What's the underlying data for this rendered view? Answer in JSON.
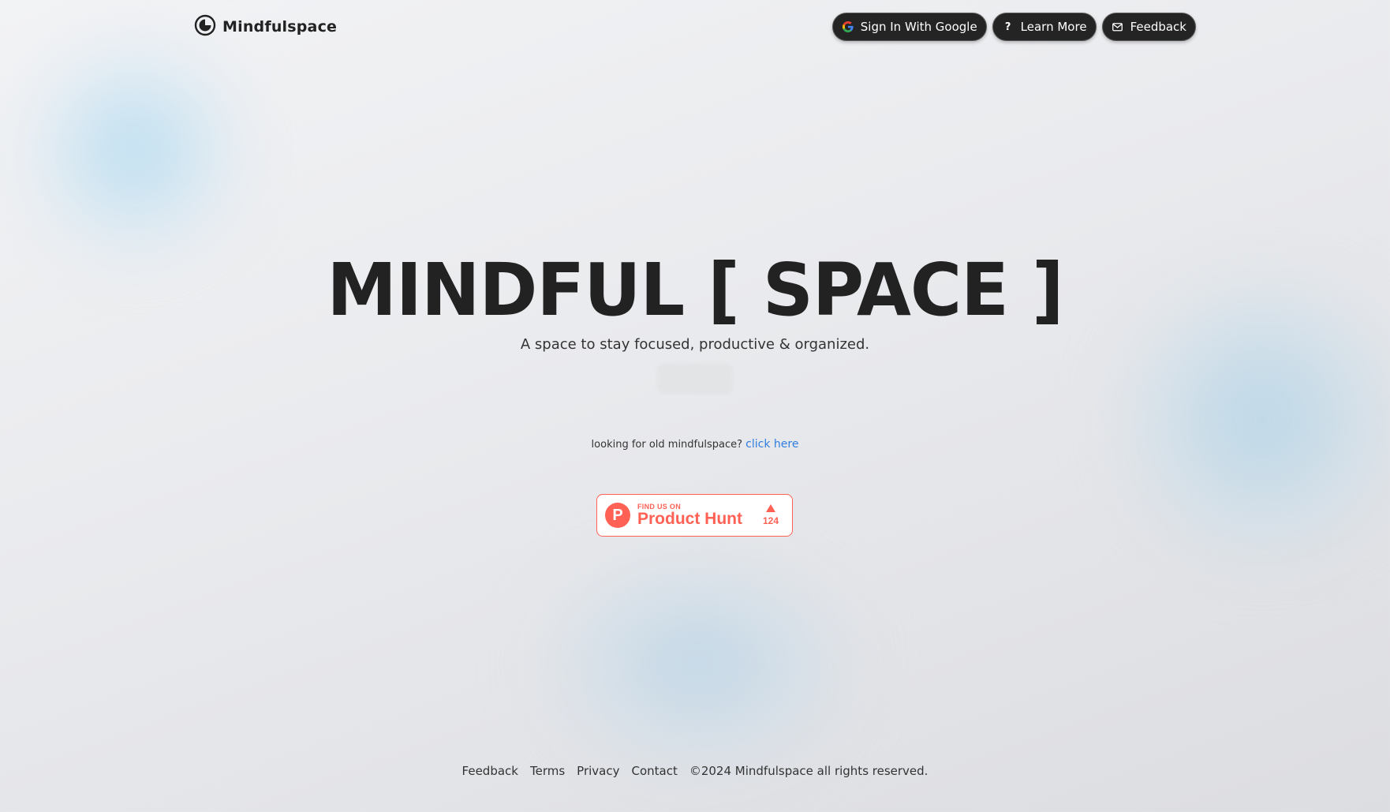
{
  "brand": {
    "name": "Mindfulspace"
  },
  "nav": {
    "signin_label": "Sign In With Google",
    "learn_label": "Learn More",
    "feedback_label": "Feedback"
  },
  "hero": {
    "title": "MINDFUL [ SPACE ]",
    "subtitle": "A space to stay focused, productive & organized."
  },
  "old_link": {
    "prompt": "looking for old mindfulspace?",
    "link_text": "click here"
  },
  "product_hunt": {
    "small_text": "FIND US ON",
    "big_text": "Product Hunt",
    "votes": "124"
  },
  "footer": {
    "links": [
      "Feedback",
      "Terms",
      "Privacy",
      "Contact"
    ],
    "copyright": "©2024 Mindfulspace all rights reserved."
  },
  "colors": {
    "button_bg": "#242424",
    "link_blue": "#2f7de1",
    "product_hunt": "#ff6154",
    "google_blue": "#4285f4",
    "google_red": "#ea4335",
    "google_yellow": "#fbbc05",
    "google_green": "#34a853"
  },
  "icons": {
    "brand": "pie-logo-icon",
    "signin": "google-icon",
    "learn": "question-icon",
    "feedback": "mail-icon",
    "product_hunt": "product-hunt-logo-icon",
    "votes": "upvote-arrow-icon"
  }
}
